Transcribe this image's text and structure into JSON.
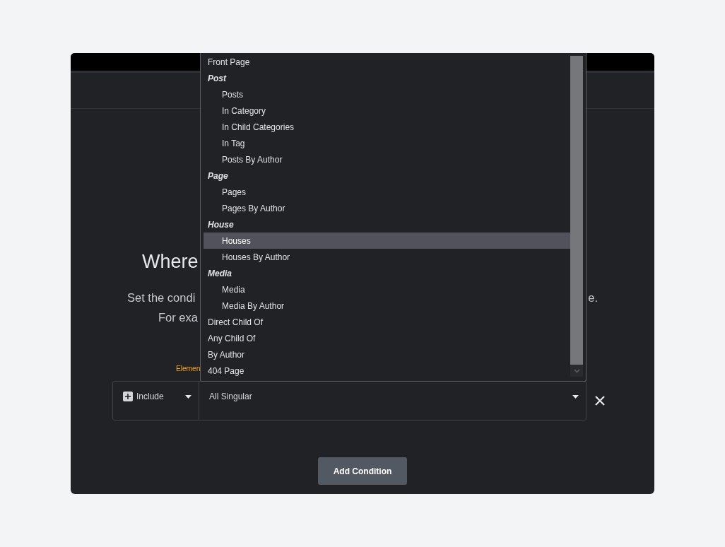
{
  "heading": "Where",
  "description": {
    "line_1_start": "Set the condi",
    "line_1_end": "e.",
    "line_2_start": "For exa"
  },
  "note": "Elemen",
  "condition": {
    "type": "Include",
    "value": "All Singular"
  },
  "add_button": "Add Condition",
  "dropdown": {
    "items": [
      {
        "kind": "option",
        "label": "Front Page",
        "selected": false
      },
      {
        "kind": "group",
        "label": "Post",
        "children": [
          {
            "label": "Posts",
            "selected": false
          },
          {
            "label": "In Category",
            "selected": false
          },
          {
            "label": "In Child Categories",
            "selected": false
          },
          {
            "label": "In Tag",
            "selected": false
          },
          {
            "label": "Posts By Author",
            "selected": false
          }
        ]
      },
      {
        "kind": "group",
        "label": "Page",
        "children": [
          {
            "label": "Pages",
            "selected": false
          },
          {
            "label": "Pages By Author",
            "selected": false
          }
        ]
      },
      {
        "kind": "group",
        "label": "House",
        "children": [
          {
            "label": "Houses",
            "selected": true
          },
          {
            "label": "Houses By Author",
            "selected": false
          }
        ]
      },
      {
        "kind": "group",
        "label": "Media",
        "children": [
          {
            "label": "Media",
            "selected": false
          },
          {
            "label": "Media By Author",
            "selected": false
          }
        ]
      },
      {
        "kind": "option",
        "label": "Direct Child Of",
        "selected": false
      },
      {
        "kind": "option",
        "label": "Any Child Of",
        "selected": false
      },
      {
        "kind": "option",
        "label": "By Author",
        "selected": false
      },
      {
        "kind": "option",
        "label": "404 Page",
        "selected": false
      }
    ]
  }
}
